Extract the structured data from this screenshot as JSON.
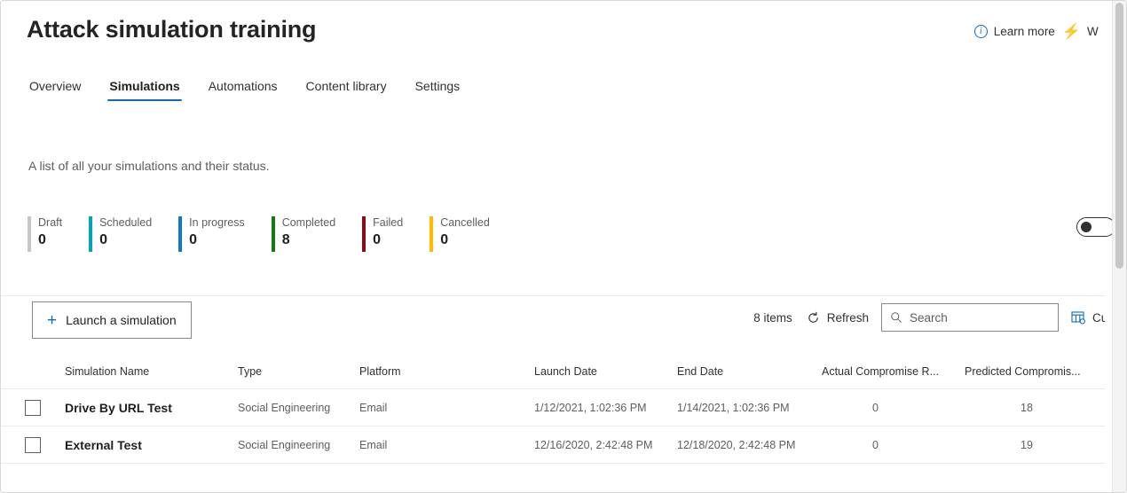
{
  "header": {
    "title": "Attack simulation training",
    "learn_more_label": "Learn more",
    "info_icon": "info-icon",
    "bolt_icon": "lightning-bolt-icon",
    "whats_new_label": "W"
  },
  "tabs": [
    {
      "label": "Overview",
      "active": false
    },
    {
      "label": "Simulations",
      "active": true
    },
    {
      "label": "Automations",
      "active": false
    },
    {
      "label": "Content library",
      "active": false
    },
    {
      "label": "Settings",
      "active": false
    }
  ],
  "description": "A list of all your simulations and their status.",
  "status_legend": [
    {
      "label": "Draft",
      "count": "0",
      "color": "#c8c6c4"
    },
    {
      "label": "Scheduled",
      "count": "0",
      "color": "#00a7b3"
    },
    {
      "label": "In progress",
      "count": "0",
      "color": "#0f78d4"
    },
    {
      "label": "Completed",
      "count": "8",
      "color": "#107c10"
    },
    {
      "label": "Failed",
      "count": "0",
      "color": "#8b0b12"
    },
    {
      "label": "Cancelled",
      "count": "0",
      "color": "#ffb900"
    }
  ],
  "toggle": {
    "name": "view-toggle",
    "state": "off"
  },
  "command_bar": {
    "launch_label": "Launch a simulation",
    "plus_icon": "plus-icon",
    "item_count": "8 items",
    "refresh_label": "Refresh",
    "refresh_icon": "refresh-icon",
    "search_placeholder": "Search",
    "search_value": "",
    "search_icon": "search-icon",
    "customize_label": "Cu",
    "columns_icon": "customize-columns-icon"
  },
  "table": {
    "columns": [
      "Simulation Name",
      "Type",
      "Platform",
      "Launch Date",
      "End Date",
      "Actual Compromise R...",
      "Predicted Compromis..."
    ],
    "rows": [
      {
        "name": "Drive By URL Test",
        "type": "Social Engineering",
        "platform": "Email",
        "launch_date": "1/12/2021, 1:02:36 PM",
        "end_date": "1/14/2021, 1:02:36 PM",
        "actual_compromise_rate": "0",
        "predicted_compromise_rate": "18"
      },
      {
        "name": "External Test",
        "type": "Social Engineering",
        "platform": "Email",
        "launch_date": "12/16/2020, 2:42:48 PM",
        "end_date": "12/18/2020, 2:42:48 PM",
        "actual_compromise_rate": "0",
        "predicted_compromise_rate": "19"
      }
    ]
  },
  "colors": {
    "accent": "#0f6cbd",
    "text_primary": "#201f1e",
    "text_secondary": "#605e5c",
    "border": "#edebe9"
  }
}
